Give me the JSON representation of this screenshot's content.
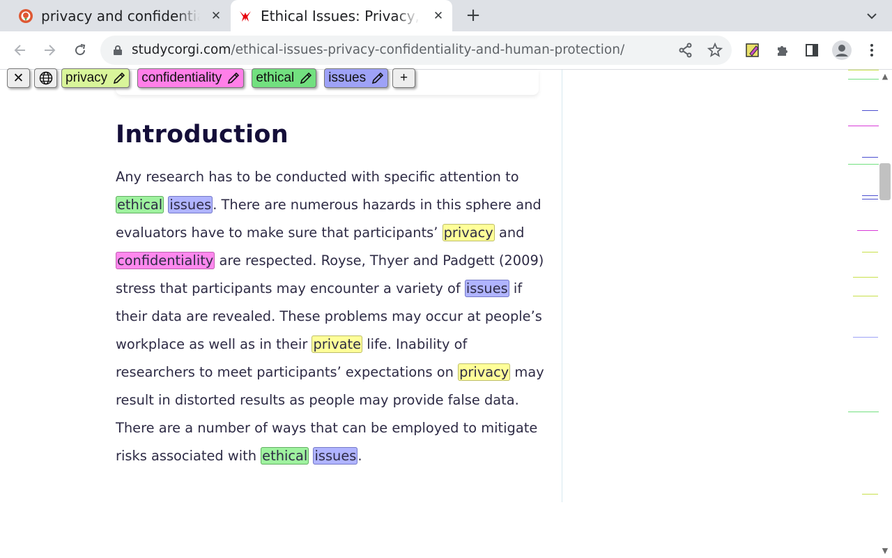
{
  "browser": {
    "tabs": [
      {
        "title": "privacy and confidentiality",
        "favicon": "duckduckgo-icon",
        "active": false
      },
      {
        "title": "Ethical Issues: Privacy, Confidentiality",
        "favicon": "studycorgi-icon",
        "active": true
      }
    ],
    "new_tab_label": "+",
    "close_glyph": "✕",
    "url": {
      "host": "studycorgi.com",
      "path": "/ethical-issues-privacy-confidentiality-and-human-protection/"
    }
  },
  "highlighter": {
    "close_glyph": "✕",
    "add_glyph": "+",
    "keywords": [
      {
        "label": "privacy",
        "color": "#d9f59a"
      },
      {
        "label": "confidentiality",
        "color": "#ff7fe8"
      },
      {
        "label": "ethical",
        "color": "#72e07f"
      },
      {
        "label": "issues",
        "color": "#9ea2f7"
      }
    ]
  },
  "article": {
    "heading": "Introduction",
    "paragraph": [
      {
        "t": "Any research has to be conducted with specific attention to "
      },
      {
        "t": "ethical",
        "k": "ethical"
      },
      {
        "t": " "
      },
      {
        "t": "issues",
        "k": "issues"
      },
      {
        "t": ". There are numerous hazards in this sphere and evaluators have to make sure that participants’ "
      },
      {
        "t": "privacy",
        "k": "privacy"
      },
      {
        "t": " and "
      },
      {
        "t": "confidentiality",
        "k": "confidentiality"
      },
      {
        "t": " are respected. Royse, Thyer and Padgett (2009) stress that participants may encounter a variety of "
      },
      {
        "t": "issues",
        "k": "issues"
      },
      {
        "t": " if their data are revealed. These problems may occur at people’s workplace as well as in their "
      },
      {
        "t": "private",
        "k": "privacy"
      },
      {
        "t": " life. Inability of researchers to meet participants’ expectations on "
      },
      {
        "t": "privacy",
        "k": "privacy"
      },
      {
        "t": " may result in distorted results as people may provide false data. There are a number of ways that can be employed to mitigate risks associated with "
      },
      {
        "t": "ethical",
        "k": "ethical"
      },
      {
        "t": " "
      },
      {
        "t": "issues",
        "k": "issues"
      },
      {
        "t": "."
      }
    ]
  },
  "colors": {
    "tabstrip_bg": "#dee1e6",
    "heading": "#140e39",
    "body_text": "#2e2b45",
    "privacy_mark": "#ffff99",
    "confidentiality_mark": "#ff88ee",
    "ethical_mark": "#9ff29f",
    "issues_mark": "#b0b4ff"
  }
}
